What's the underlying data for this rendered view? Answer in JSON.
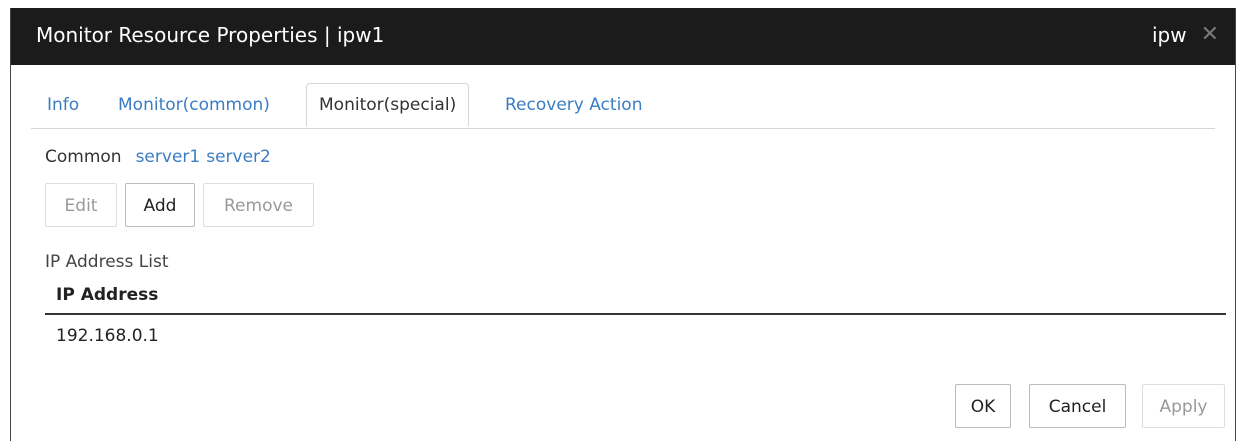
{
  "window": {
    "title": "Monitor Resource Properties | ipw1",
    "right_label": "ipw",
    "close_glyph": "✕"
  },
  "tabs": [
    {
      "label": "Info"
    },
    {
      "label": "Monitor(common)"
    },
    {
      "label": "Monitor(special)"
    },
    {
      "label": "Recovery Action"
    }
  ],
  "servers": {
    "current": "Common",
    "links": [
      "server1",
      "server2"
    ]
  },
  "toolbar": {
    "edit_label": "Edit",
    "add_label": "Add",
    "remove_label": "Remove"
  },
  "ip_list": {
    "caption": "IP Address List",
    "column_header": "IP Address",
    "rows": [
      "192.168.0.1"
    ]
  },
  "footer": {
    "ok_label": "OK",
    "cancel_label": "Cancel",
    "apply_label": "Apply"
  },
  "colors": {
    "titlebar_bg": "#1b1b1b",
    "link": "#3b7dc4",
    "disabled_text": "#999999"
  }
}
